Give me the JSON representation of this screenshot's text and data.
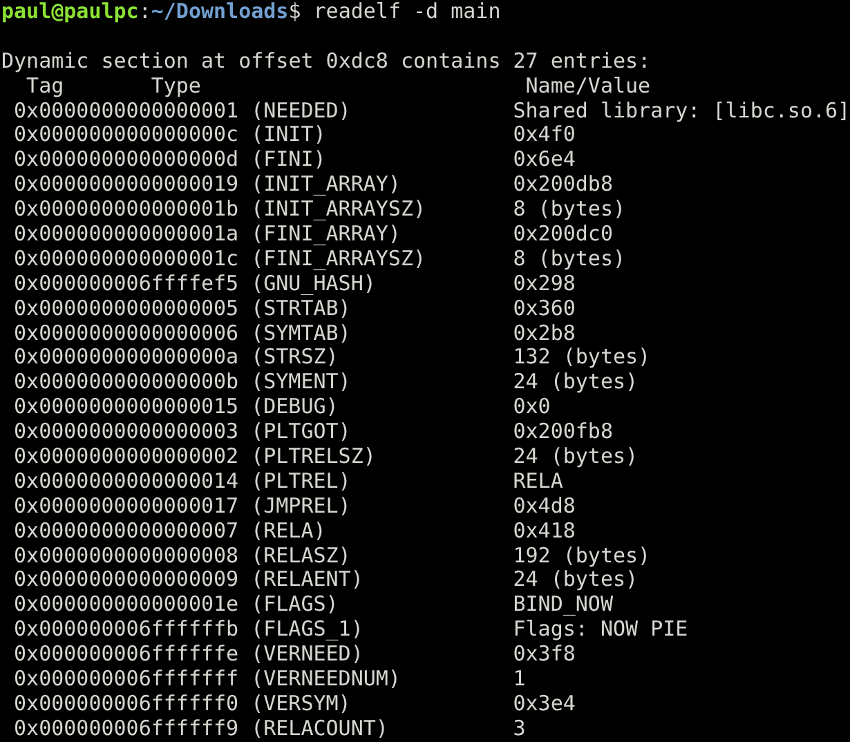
{
  "prompt": {
    "user_host": "paul@paulpc",
    "separator": ":",
    "path": "~/Downloads",
    "symbol": "$",
    "command": "readelf -d main"
  },
  "heading": "Dynamic section at offset 0xdc8 contains 27 entries:",
  "columns": [
    "Tag",
    "Type",
    "Name/Value"
  ],
  "rows": [
    {
      "tag": "0x0000000000000001",
      "type": "(NEEDED)",
      "value": "Shared library: [libc.so.6]"
    },
    {
      "tag": "0x000000000000000c",
      "type": "(INIT)",
      "value": "0x4f0"
    },
    {
      "tag": "0x000000000000000d",
      "type": "(FINI)",
      "value": "0x6e4"
    },
    {
      "tag": "0x0000000000000019",
      "type": "(INIT_ARRAY)",
      "value": "0x200db8"
    },
    {
      "tag": "0x000000000000001b",
      "type": "(INIT_ARRAYSZ)",
      "value": "8 (bytes)"
    },
    {
      "tag": "0x000000000000001a",
      "type": "(FINI_ARRAY)",
      "value": "0x200dc0"
    },
    {
      "tag": "0x000000000000001c",
      "type": "(FINI_ARRAYSZ)",
      "value": "8 (bytes)"
    },
    {
      "tag": "0x000000006ffffef5",
      "type": "(GNU_HASH)",
      "value": "0x298"
    },
    {
      "tag": "0x0000000000000005",
      "type": "(STRTAB)",
      "value": "0x360"
    },
    {
      "tag": "0x0000000000000006",
      "type": "(SYMTAB)",
      "value": "0x2b8"
    },
    {
      "tag": "0x000000000000000a",
      "type": "(STRSZ)",
      "value": "132 (bytes)"
    },
    {
      "tag": "0x000000000000000b",
      "type": "(SYMENT)",
      "value": "24 (bytes)"
    },
    {
      "tag": "0x0000000000000015",
      "type": "(DEBUG)",
      "value": "0x0"
    },
    {
      "tag": "0x0000000000000003",
      "type": "(PLTGOT)",
      "value": "0x200fb8"
    },
    {
      "tag": "0x0000000000000002",
      "type": "(PLTRELSZ)",
      "value": "24 (bytes)"
    },
    {
      "tag": "0x0000000000000014",
      "type": "(PLTREL)",
      "value": "RELA"
    },
    {
      "tag": "0x0000000000000017",
      "type": "(JMPREL)",
      "value": "0x4d8"
    },
    {
      "tag": "0x0000000000000007",
      "type": "(RELA)",
      "value": "0x418"
    },
    {
      "tag": "0x0000000000000008",
      "type": "(RELASZ)",
      "value": "192 (bytes)"
    },
    {
      "tag": "0x0000000000000009",
      "type": "(RELAENT)",
      "value": "24 (bytes)"
    },
    {
      "tag": "0x000000000000001e",
      "type": "(FLAGS)",
      "value": "BIND_NOW"
    },
    {
      "tag": "0x000000006ffffffb",
      "type": "(FLAGS_1)",
      "value": "Flags: NOW PIE"
    },
    {
      "tag": "0x000000006ffffffe",
      "type": "(VERNEED)",
      "value": "0x3f8"
    },
    {
      "tag": "0x000000006fffffff",
      "type": "(VERNEEDNUM)",
      "value": "1"
    },
    {
      "tag": "0x000000006ffffff0",
      "type": "(VERSYM)",
      "value": "0x3e4"
    },
    {
      "tag": "0x000000006ffffff9",
      "type": "(RELACOUNT)",
      "value": "3"
    }
  ]
}
